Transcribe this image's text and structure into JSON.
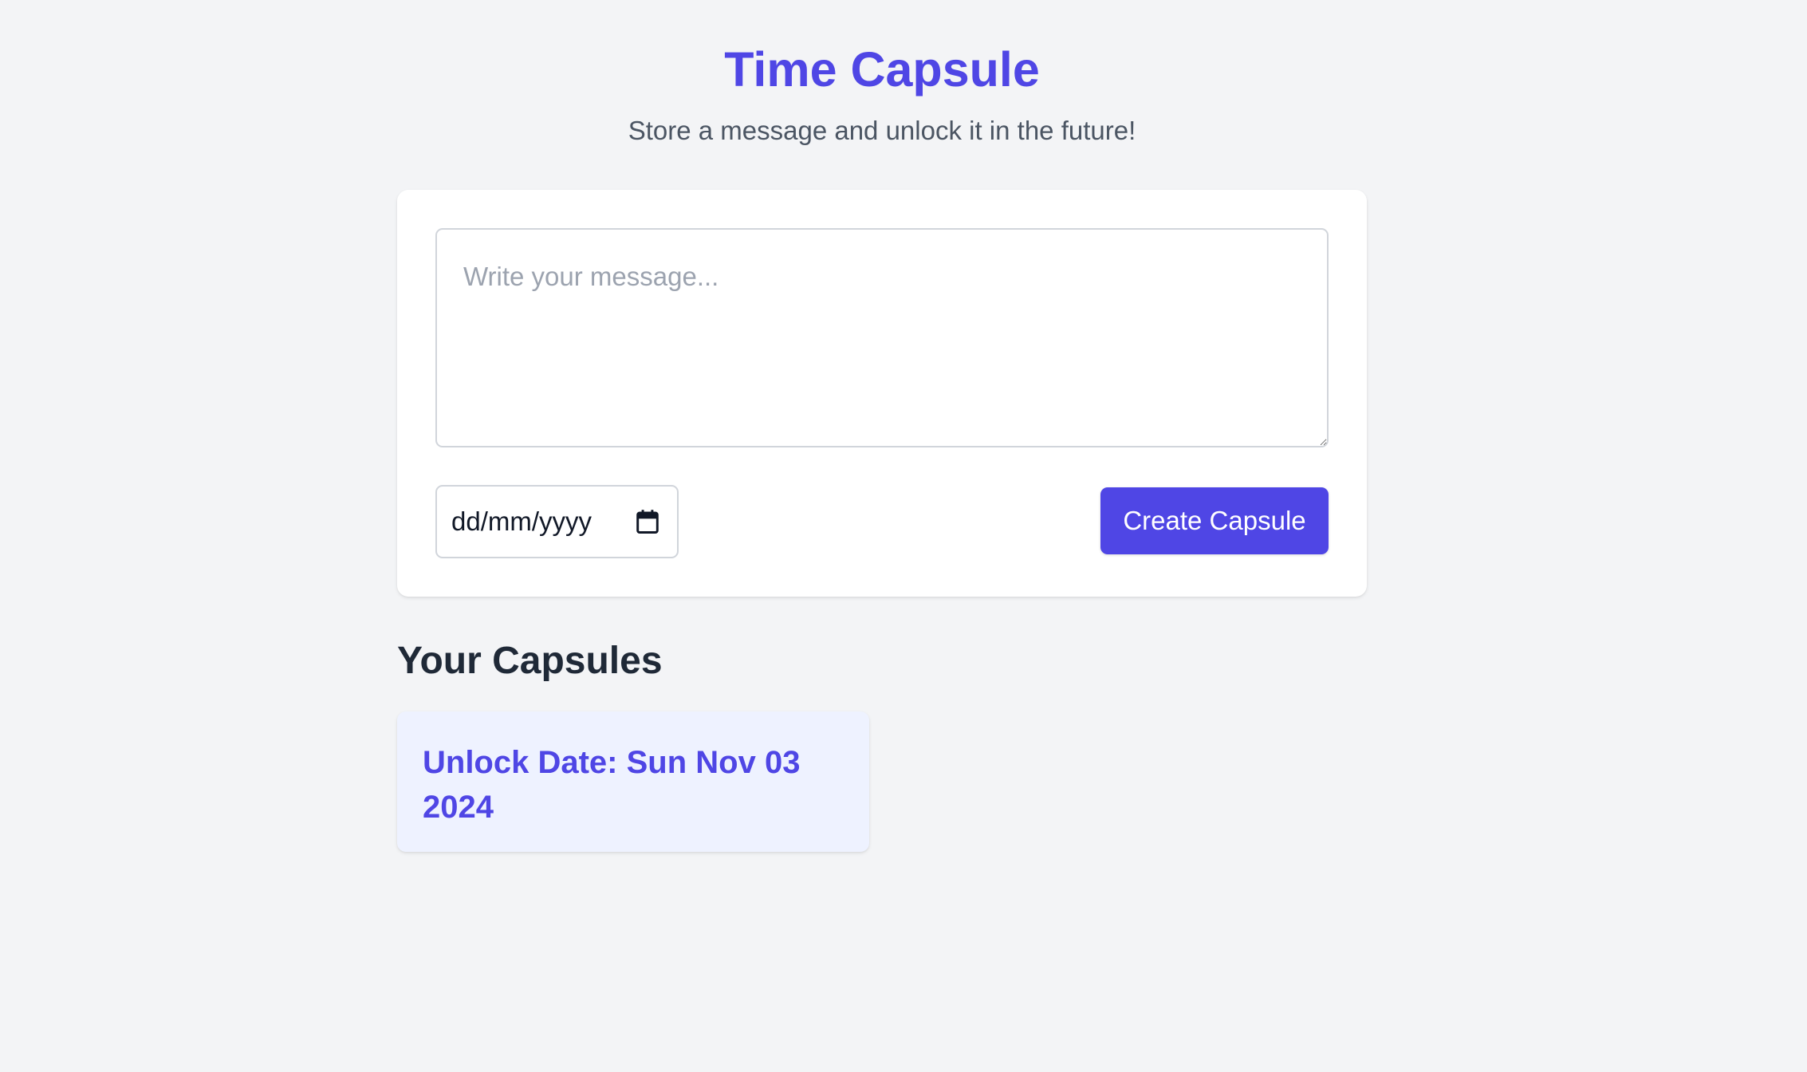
{
  "header": {
    "title": "Time Capsule",
    "subtitle": "Store a message and unlock it in the future!"
  },
  "composer": {
    "message_placeholder": "Write your message...",
    "message_value": "",
    "date_placeholder": "dd/mm/yyyy",
    "date_icon": "calendar-icon",
    "create_button_label": "Create Capsule"
  },
  "capsules": {
    "heading": "Your Capsules",
    "items": [
      {
        "unlock_label": "Unlock Date: Sun Nov 03 2024"
      }
    ]
  },
  "colors": {
    "accent": "#4f46e5",
    "background": "#f3f4f6",
    "card": "#ffffff",
    "capsule_card": "#eef2ff",
    "subtitle_text": "#4b5563",
    "heading_text": "#1f2937"
  }
}
